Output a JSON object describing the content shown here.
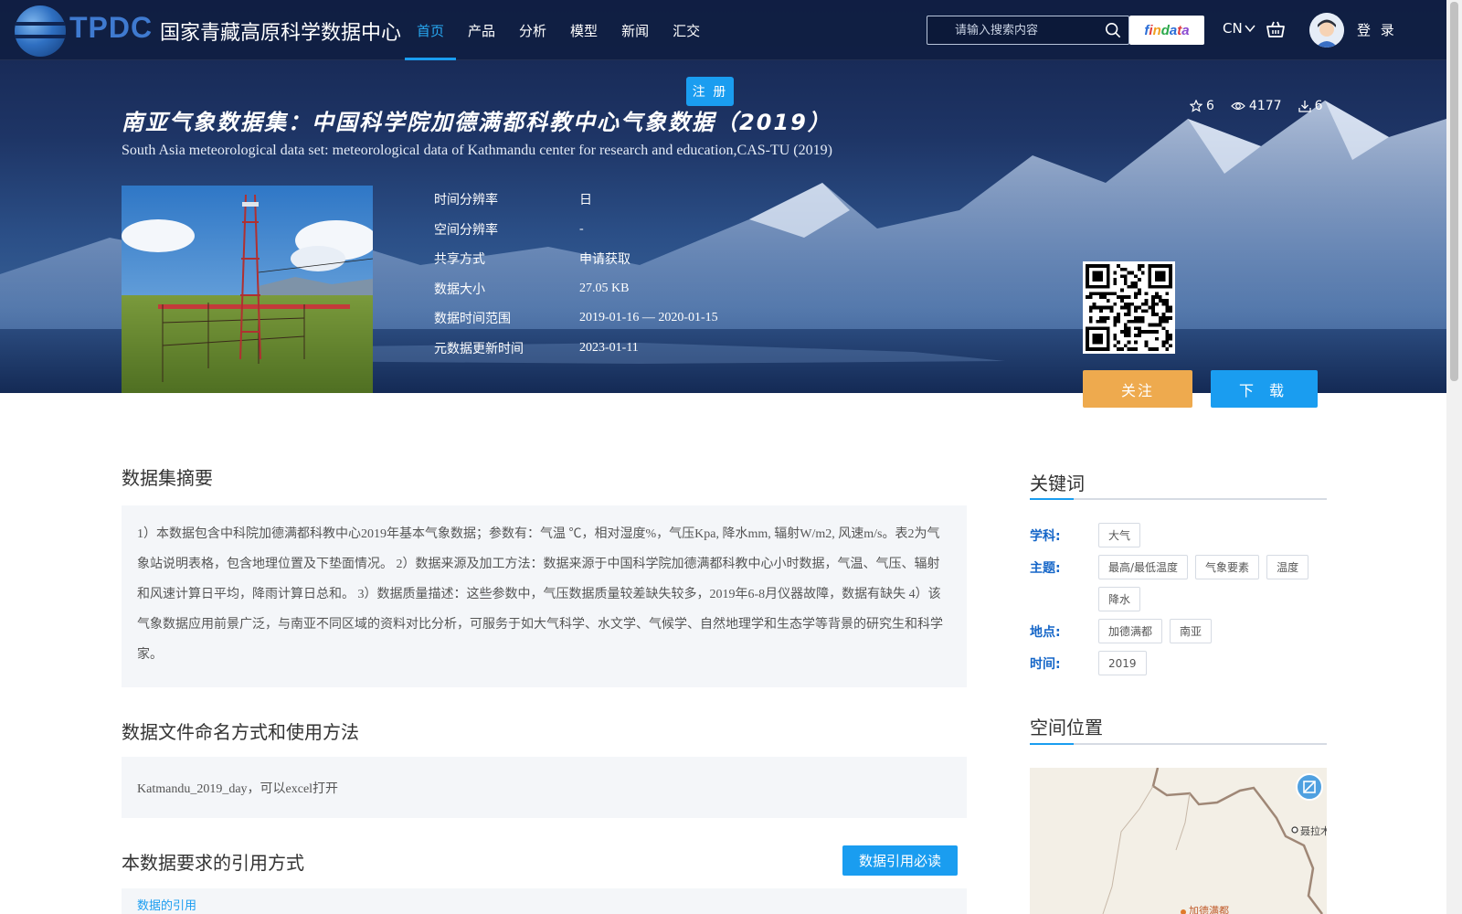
{
  "header": {
    "logo_abbr": "TPDC",
    "logo_name": "国家青藏高原科学数据中心",
    "nav": [
      {
        "label": "首页",
        "active": true
      },
      {
        "label": "产品",
        "active": false
      },
      {
        "label": "分析",
        "active": false
      },
      {
        "label": "模型",
        "active": false
      },
      {
        "label": "新闻",
        "active": false
      },
      {
        "label": "汇交",
        "active": false
      }
    ],
    "search": {
      "placeholder": "请输入搜索内容"
    },
    "findata_letters": [
      "f",
      "i",
      "n",
      "d",
      "a",
      "t",
      "a"
    ],
    "lang": "CN",
    "login": "登 录",
    "register": "注 册"
  },
  "dataset": {
    "title_cn": "南亚气象数据集：中国科学院加德满都科教中心气象数据（2019）",
    "title_en": "South Asia meteorological data set: meteorological data of Kathmandu center for research and education,CAS-TU (2019)",
    "stats": {
      "stars": "6",
      "views": "4177",
      "downloads": "6"
    },
    "meta": [
      {
        "label": "时间分辨率",
        "value": "日"
      },
      {
        "label": "空间分辨率",
        "value": "-"
      },
      {
        "label": "共享方式",
        "value": "申请获取"
      },
      {
        "label": "数据大小",
        "value": "27.05 KB"
      },
      {
        "label": "数据时间范围",
        "value": "2019-01-16 — 2020-01-15"
      },
      {
        "label": "元数据更新时间",
        "value": "2023-01-11"
      }
    ],
    "follow_label": "关注",
    "download_label": "下 载"
  },
  "body": {
    "abstract_heading": "数据集摘要",
    "abstract_text": "1）本数据包含中科院加德满都科教中心2019年基本气象数据；参数有：气温 ℃，相对湿度%，气压Kpa, 降水mm, 辐射W/m2, 风速m/s。表2为气象站说明表格，包含地理位置及下垫面情况。 2）数据来源及加工方法：数据来源于中国科学院加德满都科教中心小时数据，气温、气压、辐射和风速计算日平均，降雨计算日总和。 3）数据质量描述：这些参数中，气压数据质量较差缺失较多，2019年6-8月仪器故障，数据有缺失 4）该气象数据应用前景广泛，与南亚不同区域的资料对比分析，可服务于如大气科学、水文学、气候学、自然地理学和生态学等背景的研究生和科学家。",
    "file_heading": "数据文件命名方式和使用方法",
    "file_text": "Katmandu_2019_day，可以excel打开",
    "cite_heading": "本数据要求的引用方式",
    "cite_button": "数据引用必读",
    "cite_link": "数据的引用"
  },
  "sidebar": {
    "keywords_heading": "关键词",
    "keywords": [
      {
        "label": "学科:",
        "tags": [
          "大气"
        ]
      },
      {
        "label": "主题:",
        "tags": [
          "最高/最低温度",
          "气象要素",
          "温度",
          "降水"
        ]
      },
      {
        "label": "地点:",
        "tags": [
          "加德满都",
          "南亚"
        ]
      },
      {
        "label": "时间:",
        "tags": [
          "2019"
        ]
      }
    ],
    "location_heading": "空间位置",
    "map_labels": {
      "place1": "聂拉木",
      "place2": "加德满都"
    }
  },
  "colors": {
    "accent": "#1a9df0",
    "follow": "#eeaa4e",
    "keyword_label": "#1566c8"
  }
}
